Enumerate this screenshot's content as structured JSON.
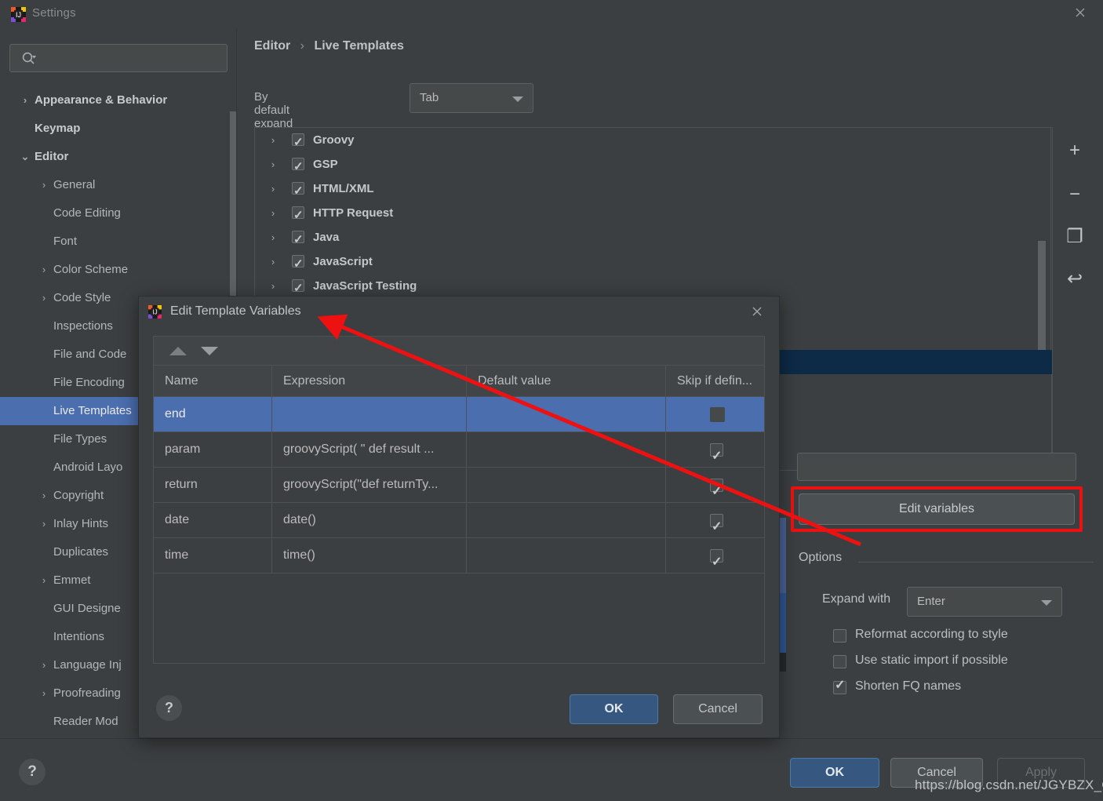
{
  "window": {
    "title": "Settings",
    "close_icon": "close-icon",
    "app_icon": "intellij-idea-logo"
  },
  "sidebar": {
    "search": {
      "placeholder": "",
      "value": "",
      "icon": "search-icon"
    },
    "items": [
      {
        "label": "Appearance & Behavior",
        "level": 0,
        "arrow": "›",
        "bold": true,
        "selected": false
      },
      {
        "label": "Keymap",
        "level": 0,
        "arrow": "",
        "bold": true,
        "selected": false
      },
      {
        "label": "Editor",
        "level": 0,
        "arrow": "⌄",
        "bold": true,
        "selected": false
      },
      {
        "label": "General",
        "level": 1,
        "arrow": "›",
        "bold": false,
        "selected": false
      },
      {
        "label": "Code Editing",
        "level": 1,
        "arrow": "",
        "bold": false,
        "selected": false
      },
      {
        "label": "Font",
        "level": 1,
        "arrow": "",
        "bold": false,
        "selected": false
      },
      {
        "label": "Color Scheme",
        "level": 1,
        "arrow": "›",
        "bold": false,
        "selected": false
      },
      {
        "label": "Code Style",
        "level": 1,
        "arrow": "›",
        "bold": false,
        "selected": false
      },
      {
        "label": "Inspections",
        "level": 1,
        "arrow": "",
        "bold": false,
        "selected": false
      },
      {
        "label": "File and Code",
        "level": 1,
        "arrow": "",
        "bold": false,
        "selected": false
      },
      {
        "label": "File Encoding",
        "level": 1,
        "arrow": "",
        "bold": false,
        "selected": false
      },
      {
        "label": "Live Templates",
        "level": 1,
        "arrow": "",
        "bold": false,
        "selected": true
      },
      {
        "label": "File Types",
        "level": 1,
        "arrow": "",
        "bold": false,
        "selected": false
      },
      {
        "label": "Android Layo",
        "level": 1,
        "arrow": "",
        "bold": false,
        "selected": false
      },
      {
        "label": "Copyright",
        "level": 1,
        "arrow": "›",
        "bold": false,
        "selected": false
      },
      {
        "label": "Inlay Hints",
        "level": 1,
        "arrow": "›",
        "bold": false,
        "selected": false
      },
      {
        "label": "Duplicates",
        "level": 1,
        "arrow": "",
        "bold": false,
        "selected": false
      },
      {
        "label": "Emmet",
        "level": 1,
        "arrow": "›",
        "bold": false,
        "selected": false
      },
      {
        "label": "GUI Designe",
        "level": 1,
        "arrow": "",
        "bold": false,
        "selected": false
      },
      {
        "label": "Intentions",
        "level": 1,
        "arrow": "",
        "bold": false,
        "selected": false
      },
      {
        "label": "Language Inj",
        "level": 1,
        "arrow": "›",
        "bold": false,
        "selected": false
      },
      {
        "label": "Proofreading",
        "level": 1,
        "arrow": "›",
        "bold": false,
        "selected": false
      },
      {
        "label": "Reader Mod",
        "level": 1,
        "arrow": "",
        "bold": false,
        "selected": false
      }
    ]
  },
  "main": {
    "breadcrumb": {
      "parent": "Editor",
      "separator": "›",
      "current": "Live Templates"
    },
    "expand_default": {
      "label": "By default expand with",
      "value": "Tab"
    },
    "template_groups": [
      {
        "label": "Groovy",
        "checked": true
      },
      {
        "label": "GSP",
        "checked": true
      },
      {
        "label": "HTML/XML",
        "checked": true
      },
      {
        "label": "HTTP Request",
        "checked": true
      },
      {
        "label": "Java",
        "checked": true
      },
      {
        "label": "JavaScript",
        "checked": true
      },
      {
        "label": "JavaScript Testing",
        "checked": true
      }
    ],
    "toolbar_icons": [
      {
        "name": "add-icon",
        "glyph": "+"
      },
      {
        "name": "remove-icon",
        "glyph": "−"
      },
      {
        "name": "copy-icon",
        "glyph": "❐"
      },
      {
        "name": "revert-icon",
        "glyph": "↩"
      }
    ]
  },
  "right_panel": {
    "edit_variables_label": "Edit variables",
    "options_label": "Options",
    "expand_with": {
      "label": "Expand with",
      "value": "Enter"
    },
    "checkboxes": [
      {
        "label": "Reformat according to style",
        "checked": false
      },
      {
        "label": "Use static import if possible",
        "checked": false
      },
      {
        "label": "Shorten FQ names",
        "checked": true
      }
    ]
  },
  "bottom": {
    "help_glyph": "?",
    "ok": "OK",
    "cancel": "Cancel",
    "apply": "Apply",
    "watermark": "https://blog.csdn.net/JGYBZX_G"
  },
  "dialog": {
    "title": "Edit Template Variables",
    "close_icon": "close-icon",
    "sort_up_icon": "move-up-icon",
    "sort_down_icon": "move-down-icon",
    "columns": [
      "Name",
      "Expression",
      "Default value",
      "Skip if defin..."
    ],
    "rows": [
      {
        "name": "end",
        "expression": "",
        "default": "",
        "skip": false,
        "skip_blank": true,
        "selected": true
      },
      {
        "name": "param",
        "expression": "groovyScript(  \"   def result ...",
        "default": "",
        "skip": true,
        "skip_blank": false,
        "selected": false
      },
      {
        "name": "return",
        "expression": "groovyScript(\"def returnTy...",
        "default": "",
        "skip": true,
        "skip_blank": false,
        "selected": false
      },
      {
        "name": "date",
        "expression": "date()",
        "default": "",
        "skip": true,
        "skip_blank": false,
        "selected": false
      },
      {
        "name": "time",
        "expression": "time()",
        "default": "",
        "skip": true,
        "skip_blank": false,
        "selected": false
      }
    ],
    "help_glyph": "?",
    "ok": "OK",
    "cancel": "Cancel"
  },
  "annotation": {
    "highlight_color": "#ee1111",
    "arrow_color": "#ee1111"
  }
}
